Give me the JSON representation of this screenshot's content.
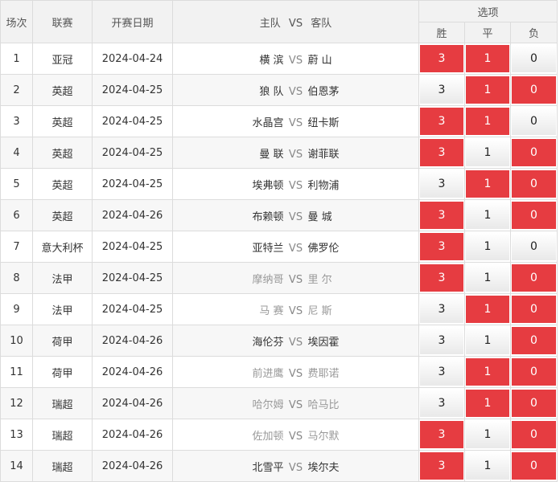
{
  "header": {
    "index": "场次",
    "league": "联赛",
    "date": "开赛日期",
    "home": "主队",
    "vs": "VS",
    "away": "客队",
    "options": "选项",
    "win": "胜",
    "draw": "平",
    "lose": "负"
  },
  "colors": {
    "selected": "#e63c41"
  },
  "rows": [
    {
      "n": "1",
      "league": "亚冠",
      "date": "2024-04-24",
      "home": "横 滨",
      "away": "蔚 山",
      "dim": false,
      "w": "3",
      "d": "1",
      "l": "0",
      "sel": [
        true,
        true,
        false
      ]
    },
    {
      "n": "2",
      "league": "英超",
      "date": "2024-04-25",
      "home": "狼 队",
      "away": "伯恩茅",
      "dim": false,
      "w": "3",
      "d": "1",
      "l": "0",
      "sel": [
        false,
        true,
        true
      ]
    },
    {
      "n": "3",
      "league": "英超",
      "date": "2024-04-25",
      "home": "水晶宫",
      "away": "纽卡斯",
      "dim": false,
      "w": "3",
      "d": "1",
      "l": "0",
      "sel": [
        true,
        true,
        false
      ]
    },
    {
      "n": "4",
      "league": "英超",
      "date": "2024-04-25",
      "home": "曼 联",
      "away": "谢菲联",
      "dim": false,
      "w": "3",
      "d": "1",
      "l": "0",
      "sel": [
        true,
        false,
        true
      ]
    },
    {
      "n": "5",
      "league": "英超",
      "date": "2024-04-25",
      "home": "埃弗顿",
      "away": "利物浦",
      "dim": false,
      "w": "3",
      "d": "1",
      "l": "0",
      "sel": [
        false,
        true,
        true
      ]
    },
    {
      "n": "6",
      "league": "英超",
      "date": "2024-04-26",
      "home": "布赖顿",
      "away": "曼 城",
      "dim": false,
      "w": "3",
      "d": "1",
      "l": "0",
      "sel": [
        true,
        false,
        true
      ]
    },
    {
      "n": "7",
      "league": "意大利杯",
      "date": "2024-04-25",
      "home": "亚特兰",
      "away": "佛罗伦",
      "dim": false,
      "w": "3",
      "d": "1",
      "l": "0",
      "sel": [
        true,
        false,
        false
      ]
    },
    {
      "n": "8",
      "league": "法甲",
      "date": "2024-04-25",
      "home": "摩纳哥",
      "away": "里 尔",
      "dim": true,
      "w": "3",
      "d": "1",
      "l": "0",
      "sel": [
        true,
        false,
        true
      ]
    },
    {
      "n": "9",
      "league": "法甲",
      "date": "2024-04-25",
      "home": "马 赛",
      "away": "尼 斯",
      "dim": true,
      "w": "3",
      "d": "1",
      "l": "0",
      "sel": [
        false,
        true,
        true
      ]
    },
    {
      "n": "10",
      "league": "荷甲",
      "date": "2024-04-26",
      "home": "海伦芬",
      "away": "埃因霍",
      "dim": false,
      "w": "3",
      "d": "1",
      "l": "0",
      "sel": [
        false,
        false,
        true
      ]
    },
    {
      "n": "11",
      "league": "荷甲",
      "date": "2024-04-26",
      "home": "前进鹰",
      "away": "费耶诺",
      "dim": true,
      "w": "3",
      "d": "1",
      "l": "0",
      "sel": [
        false,
        true,
        true
      ]
    },
    {
      "n": "12",
      "league": "瑞超",
      "date": "2024-04-26",
      "home": "哈尔姆",
      "away": "哈马比",
      "dim": true,
      "w": "3",
      "d": "1",
      "l": "0",
      "sel": [
        false,
        true,
        true
      ]
    },
    {
      "n": "13",
      "league": "瑞超",
      "date": "2024-04-26",
      "home": "佐加顿",
      "away": "马尔默",
      "dim": true,
      "w": "3",
      "d": "1",
      "l": "0",
      "sel": [
        true,
        false,
        true
      ]
    },
    {
      "n": "14",
      "league": "瑞超",
      "date": "2024-04-26",
      "home": "北雪平",
      "away": "埃尔夫",
      "dim": false,
      "w": "3",
      "d": "1",
      "l": "0",
      "sel": [
        true,
        false,
        true
      ]
    }
  ]
}
